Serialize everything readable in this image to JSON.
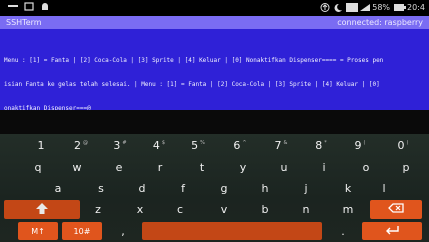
{
  "status": {
    "battery_pct": "58%",
    "time": "20:4"
  },
  "app": {
    "title": "SSHTerm",
    "connection": "connected: raspberry"
  },
  "terminal": {
    "lines": [
      "Menu : [1] = Fanta | [2] Coca-Cola | [3] Sprite | [4] Keluar | [0] Nonaktifkan Dispenser==== = Proses pen",
      "isian Fanta ke gelas telah selesai. | Menu : [1] = Fanta | [2] Coca-Cola | [3] Sprite | [4] Keluar | [0]",
      "onaktifkan Dispenser===@"
    ]
  },
  "keyboard": {
    "number_row": [
      {
        "key": "1",
        "sub": ""
      },
      {
        "key": "2",
        "sub": "@"
      },
      {
        "key": "3",
        "sub": "#"
      },
      {
        "key": "4",
        "sub": "$"
      },
      {
        "key": "5",
        "sub": "%"
      },
      {
        "key": "6",
        "sub": "^"
      },
      {
        "key": "7",
        "sub": "&"
      },
      {
        "key": "8",
        "sub": "*"
      },
      {
        "key": "9",
        "sub": "("
      },
      {
        "key": "0",
        "sub": ")"
      }
    ],
    "row1": [
      "q",
      "w",
      "e",
      "r",
      "t",
      "y",
      "u",
      "i",
      "o",
      "p"
    ],
    "row2": [
      "a",
      "s",
      "d",
      "f",
      "g",
      "h",
      "j",
      "k",
      "l"
    ],
    "row3": [
      "z",
      "x",
      "c",
      "v",
      "b",
      "n",
      "m"
    ],
    "bottom": {
      "left1": "M↑",
      "left2": "10#",
      "comma": ",",
      "period": "."
    },
    "colors": {
      "accent": "#e0551d",
      "terminal_bg": "#2f21d7",
      "title_bg": "#7a6cf3"
    },
    "icons": [
      "shift-icon",
      "backspace-icon",
      "enter-icon",
      "space-bar"
    ]
  }
}
